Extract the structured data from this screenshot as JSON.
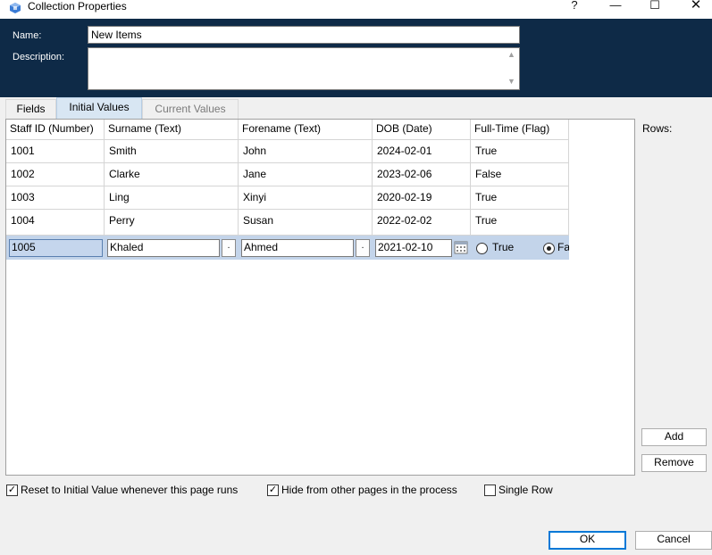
{
  "window": {
    "title": "Collection Properties",
    "help_glyph": "?",
    "min_glyph": "—",
    "max_glyph": "☐",
    "close_glyph": "✕"
  },
  "header": {
    "name_label": "Name:",
    "name_value": "New Items",
    "description_label": "Description:",
    "description_value": ""
  },
  "tabs": [
    {
      "label": "Fields",
      "state": "normal"
    },
    {
      "label": "Initial Values",
      "state": "selected"
    },
    {
      "label": "Current Values",
      "state": "disabled"
    }
  ],
  "grid": {
    "columns": [
      "Staff ID (Number)",
      "Surname (Text)",
      "Forename (Text)",
      "DOB (Date)",
      "Full-Time (Flag)"
    ],
    "rows": [
      [
        "1001",
        "Smith",
        "John",
        "2024-02-01",
        "True"
      ],
      [
        "1002",
        "Clarke",
        "Jane",
        "2023-02-06",
        "False"
      ],
      [
        "1003",
        "Ling",
        "Xinyi",
        "2020-02-19",
        "True"
      ],
      [
        "1004",
        "Perry",
        "Susan",
        "2022-02-02",
        "True"
      ]
    ],
    "edit_row": {
      "staff_id": "1005",
      "surname": "Khaled",
      "forename": "Ahmed",
      "dob": "2021-02-10",
      "flag_true_label": "True",
      "flag_false_label": "Fa",
      "ellipsis": ".",
      "selected_flag": "False"
    }
  },
  "side": {
    "rows_label": "Rows:",
    "add_label": "Add",
    "remove_label": "Remove"
  },
  "options": [
    {
      "label": "Reset to Initial Value whenever this page runs",
      "checked": true
    },
    {
      "label": "Hide from other pages in the process",
      "checked": true
    },
    {
      "label": "Single Row",
      "checked": false
    }
  ],
  "check_glyph": "✓",
  "footer": {
    "ok_label": "OK",
    "cancel_label": "Cancel"
  },
  "colors": {
    "header_bg": "#0e2a47",
    "selected_row": "#c3d4ea",
    "selected_tab": "#d8e6f3",
    "default_button_border": "#0078d7"
  }
}
